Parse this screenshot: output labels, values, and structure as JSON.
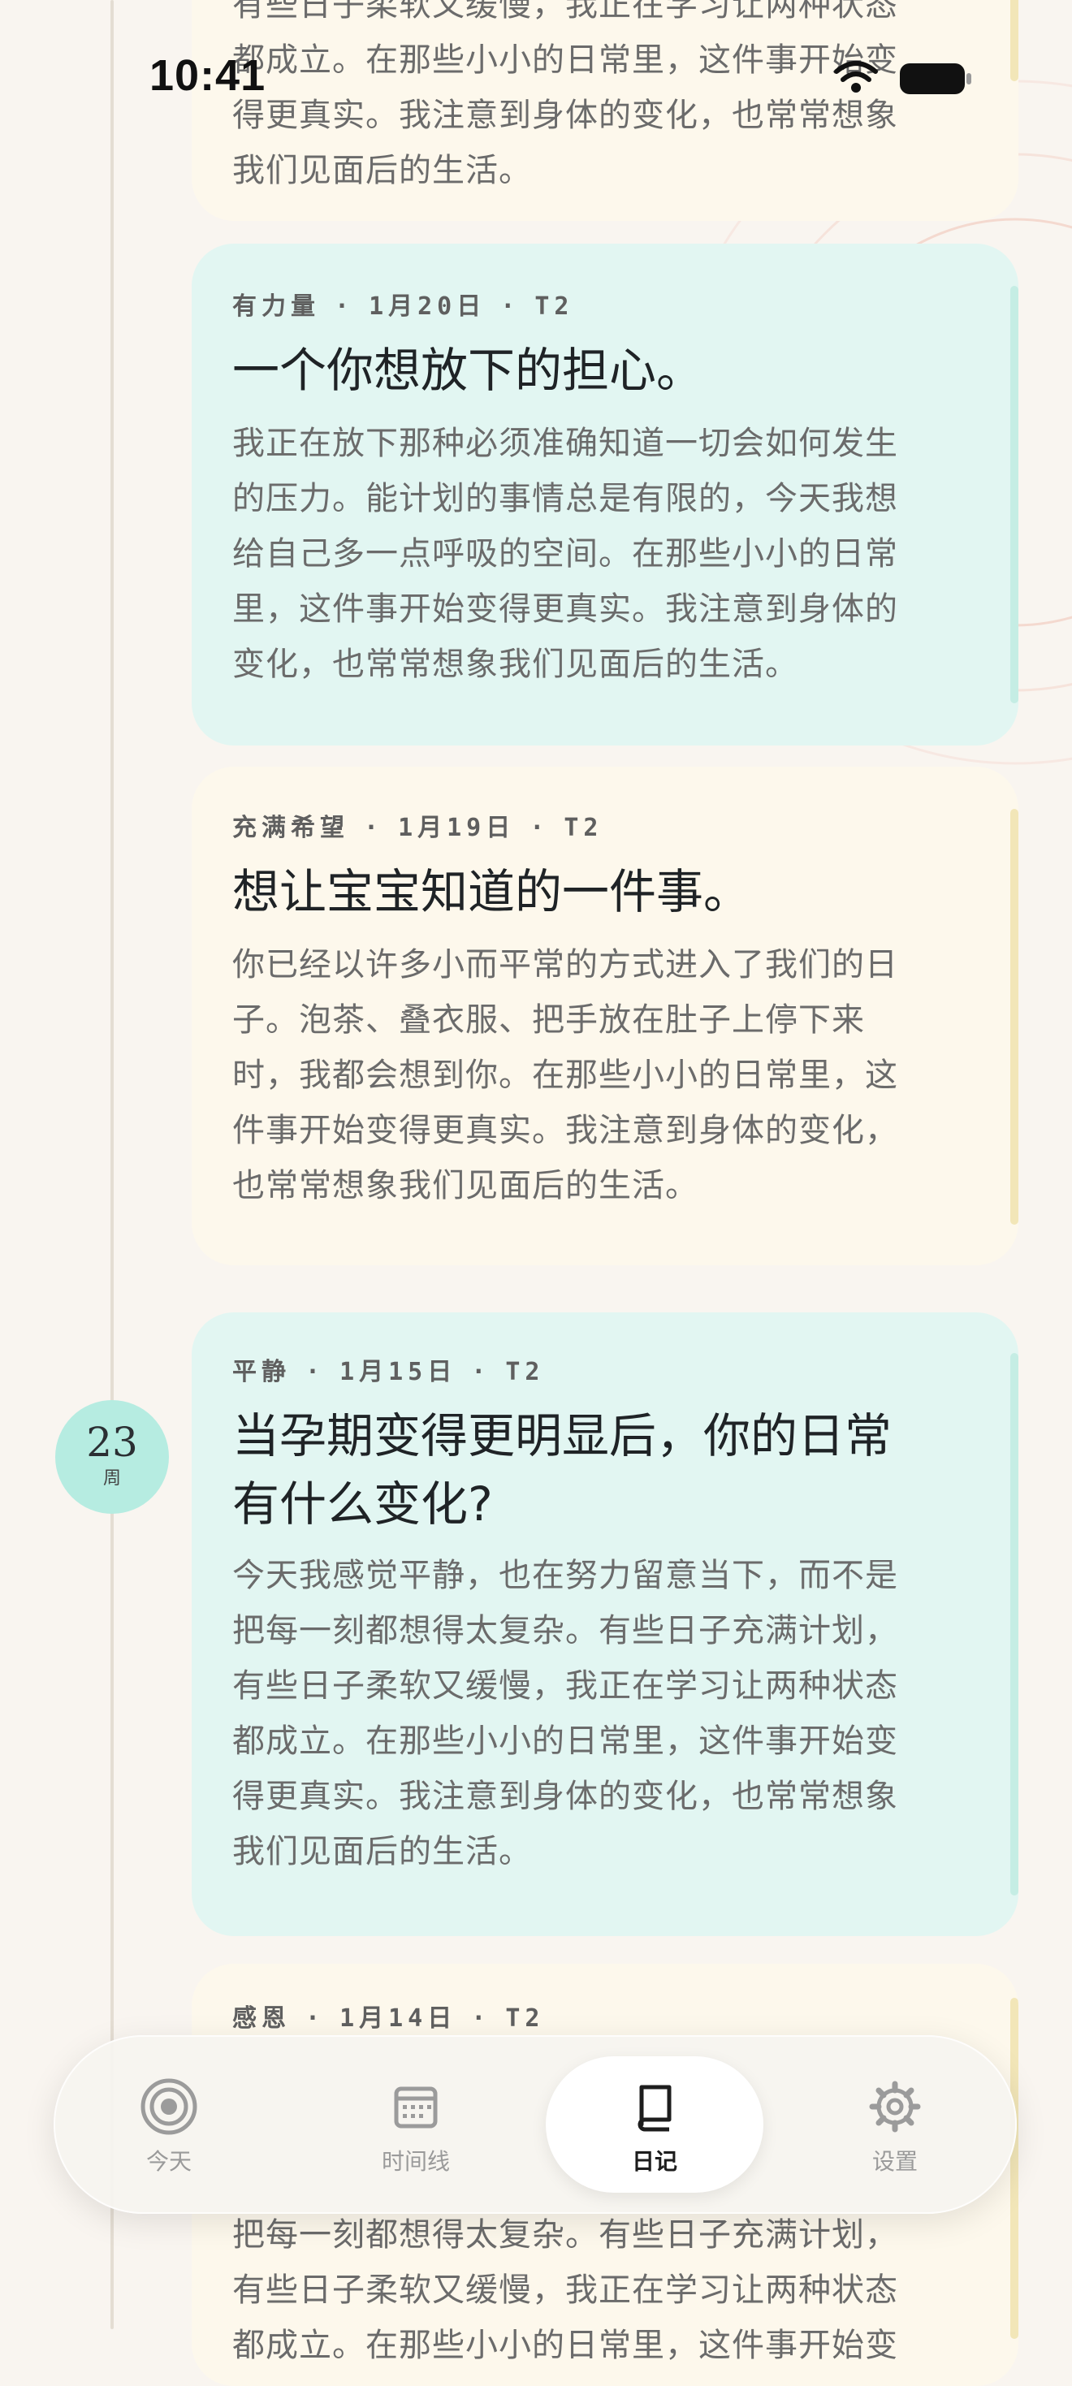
{
  "status_bar": {
    "time": "10:41"
  },
  "entries": [
    {
      "mood": "",
      "date": "",
      "trimester": "",
      "title": "",
      "lines": [
        "有些日子柔软又缓慢，我正在学习让两种状态",
        "都成立。在那些小小的日常里，这件事开始变",
        "得更真实。我注意到身体的变化，也常常想象",
        "我们见面后的生活。"
      ]
    },
    {
      "mood": "有力量",
      "date": "1月20日",
      "trimester": "T2",
      "title": "一个你想放下的担心。",
      "lines": [
        "我正在放下那种必须准确知道一切会如何发生",
        "的压力。能计划的事情总是有限的，今天我想",
        "给自己多一点呼吸的空间。在那些小小的日常",
        "里，这件事开始变得更真实。我注意到身体的",
        "变化，也常常想象我们见面后的生活。"
      ]
    },
    {
      "mood": "充满希望",
      "date": "1月19日",
      "trimester": "T2",
      "title": "想让宝宝知道的一件事。",
      "lines": [
        "你已经以许多小而平常的方式进入了我们的日",
        "子。泡茶、叠衣服、把手放在肚子上停下来",
        "时，我都会想到你。在那些小小的日常里，这",
        "件事开始变得更真实。我注意到身体的变化，",
        "也常常想象我们见面后的生活。"
      ]
    },
    {
      "mood": "平静",
      "date": "1月15日",
      "trimester": "T2",
      "title_lines": [
        "当孕期变得更明显后，你的日常",
        "有什么变化?"
      ],
      "lines": [
        "今天我感觉平静，也在努力留意当下，而不是",
        "把每一刻都想得太复杂。有些日子充满计划，",
        "有些日子柔软又缓慢，我正在学习让两种状态",
        "都成立。在那些小小的日常里，这件事开始变",
        "得更真实。我注意到身体的变化，也常常想象",
        "我们见面后的生活。"
      ]
    },
    {
      "mood": "感恩",
      "date": "1月14日",
      "trimester": "T2",
      "lines": [
        "把每一刻都想得太复杂。有些日子充满计划，",
        "有些日子柔软又缓慢，我正在学习让两种状态",
        "都成立。在那些小小的日常里，这件事开始变"
      ]
    }
  ],
  "week_badge": {
    "number": "23",
    "label": "周"
  },
  "tabs": [
    {
      "label": "今天",
      "icon": "target-icon"
    },
    {
      "label": "时间线",
      "icon": "calendar-icon"
    },
    {
      "label": "日记",
      "icon": "book-icon"
    },
    {
      "label": "设置",
      "icon": "gear-icon"
    }
  ],
  "active_tab": "日记",
  "colors": {
    "background": "#f9f5f0",
    "card_cream": "#fdf8ec",
    "card_mint": "#e2f6f2",
    "accent_mint": "#b6ece1"
  }
}
